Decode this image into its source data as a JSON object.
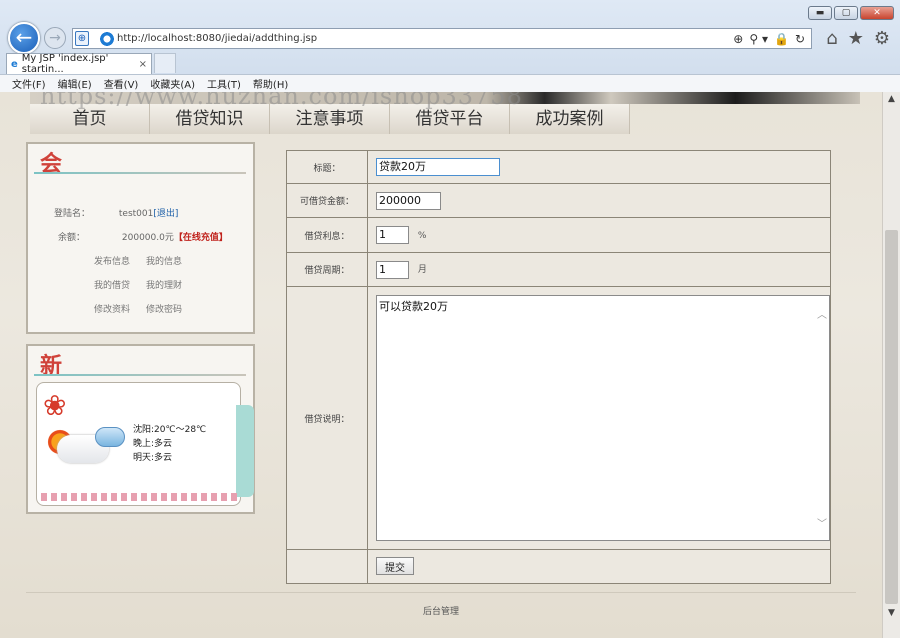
{
  "window": {
    "minimize": "▬",
    "maximize": "▢",
    "close": "✕"
  },
  "browser": {
    "back": "←",
    "forward": "→",
    "security": "⊕",
    "url": "http://localhost:8080/jiedai/addthing.jsp",
    "tab_title": "My JSP 'index.jsp' startin...",
    "tab_close": "×",
    "address_tools": [
      "⊕",
      "⚲ ▾",
      "🔒",
      "↻"
    ],
    "nav_icons": [
      "⌂",
      "★",
      "⚙"
    ],
    "menu": [
      "文件(F)",
      "编辑(E)",
      "查看(V)",
      "收藏夹(A)",
      "工具(T)",
      "帮助(H)"
    ]
  },
  "site": {
    "watermark": "https://www.huzhan.com/ishop33758",
    "nav": [
      "首页",
      "借贷知识",
      "注意事项",
      "借贷平台",
      "成功案例"
    ],
    "member_panel": {
      "title": "会",
      "login_label": "登陆名：",
      "username": "test001",
      "logout": "[退出]",
      "balance_label": "余额：",
      "balance": "200000.0元",
      "recharge": "【在线充值】",
      "links": [
        [
          "发布信息",
          "我的信息"
        ],
        [
          "我的借贷",
          "我的理财"
        ],
        [
          "修改资料",
          "修改密码"
        ]
      ]
    },
    "news_panel": {
      "title": "新",
      "leaf": "❀",
      "weather": [
        "沈阳:20℃～28℃",
        "晚上:多云",
        "明天:多云"
      ]
    },
    "form": {
      "title_label": "标题：",
      "title_value": "贷款20万",
      "amount_label": "可借贷金额：",
      "amount_value": "200000",
      "rate_label": "借贷利息：",
      "rate_value": "1",
      "rate_unit": "%",
      "period_label": "借贷周期：",
      "period_value": "1",
      "period_unit": "月",
      "desc_label": "借贷说明：",
      "desc_value": "可以贷款20万",
      "submit": "提交"
    },
    "footer": "后台管理"
  },
  "scroll": {
    "up": "▲",
    "down": "▼"
  }
}
